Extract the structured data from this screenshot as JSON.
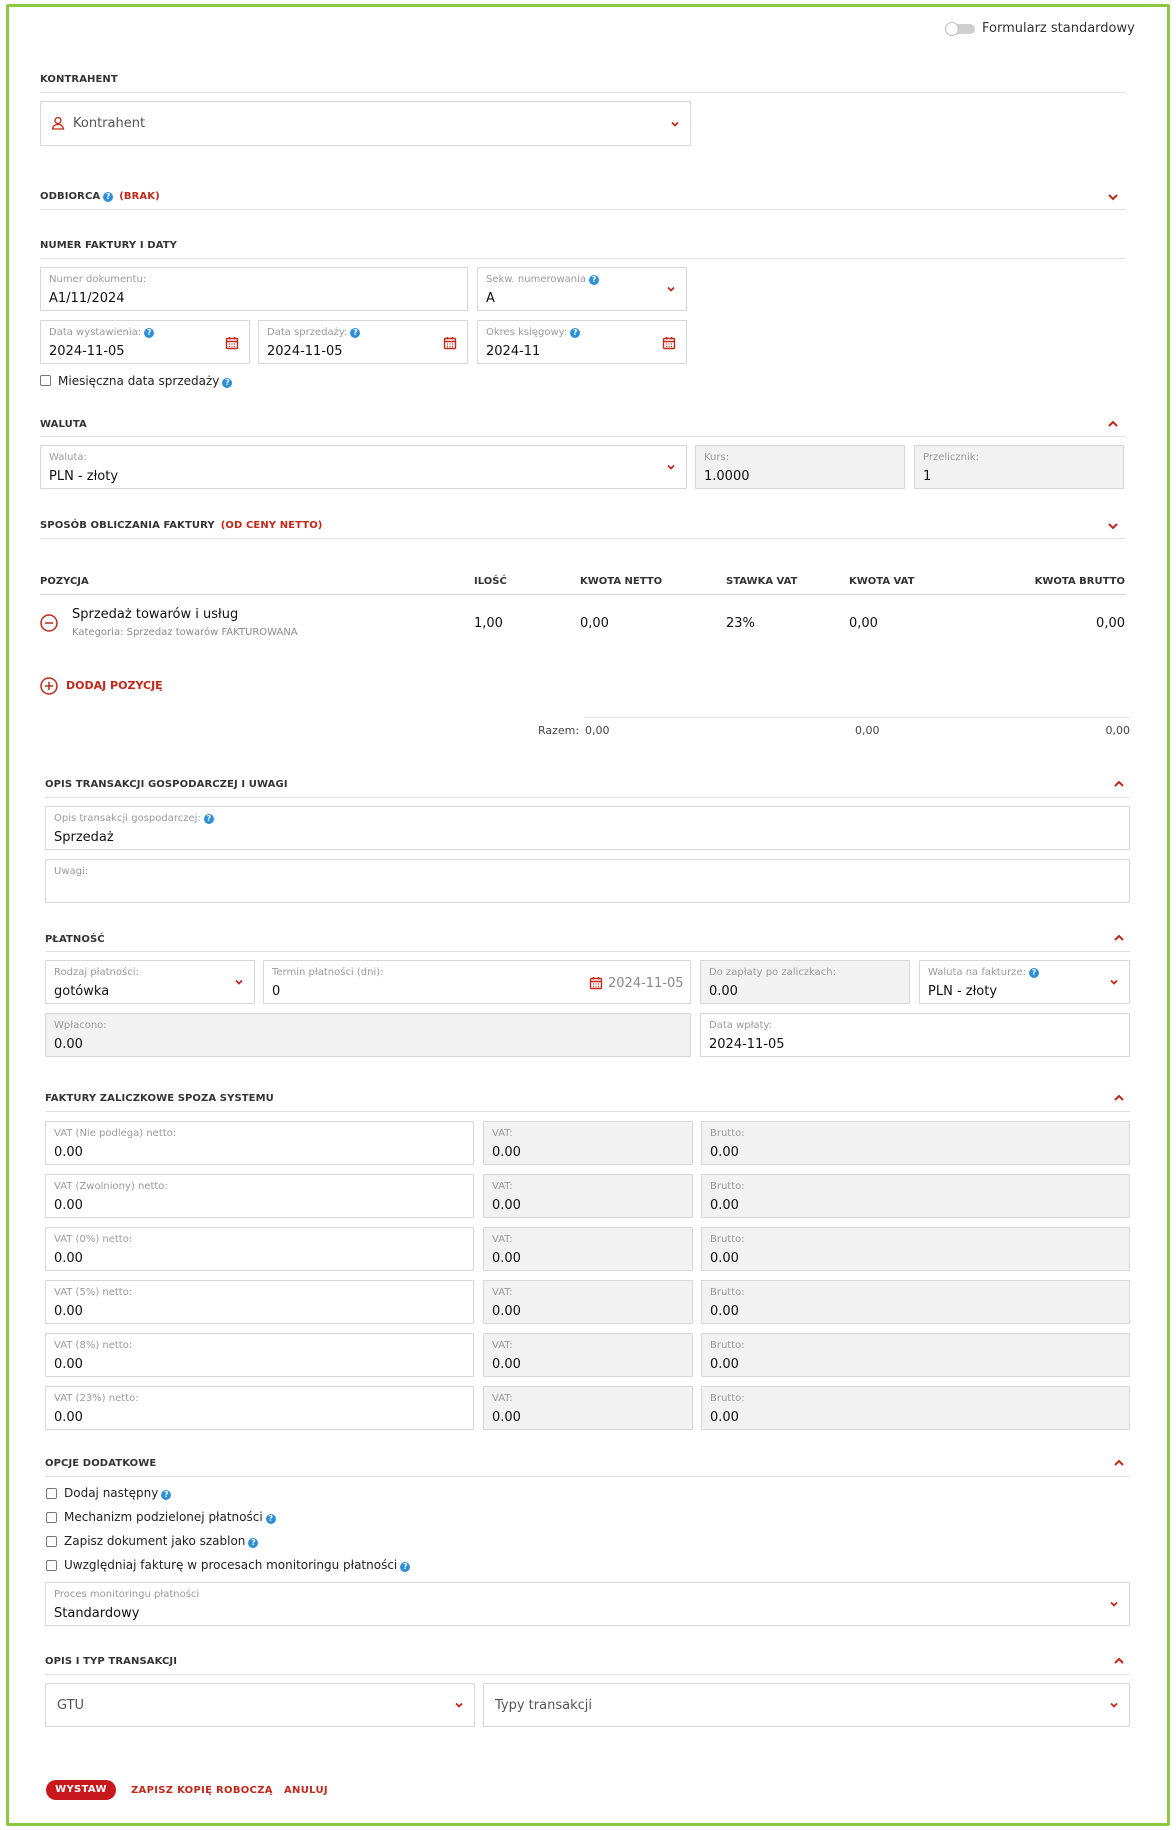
{
  "toggle": {
    "label": "Formularz standardowy"
  },
  "kontrahent": {
    "title": "KONTRAHENT",
    "placeholder": "Kontrahent"
  },
  "odbiorca": {
    "title": "ODBIORCA",
    "status": "(BRAK)"
  },
  "numer": {
    "title": "NUMER FAKTURY I DATY",
    "doc_number": {
      "label": "Numer dokumentu:",
      "value": "A1/11/2024"
    },
    "sequence": {
      "label": "Sekw. numerowania",
      "value": "A"
    },
    "issue_date": {
      "label": "Data wystawienia:",
      "value": "2024-11-05"
    },
    "sale_date": {
      "label": "Data sprzedaży:",
      "value": "2024-11-05"
    },
    "period": {
      "label": "Okres księgowy:",
      "value": "2024-11"
    },
    "monthly_label": "Miesięczna data sprzedaży"
  },
  "waluta": {
    "title": "WALUTA",
    "currency": {
      "label": "Waluta:",
      "value": "PLN - złoty"
    },
    "rate": {
      "label": "Kurs:",
      "value": "1.0000"
    },
    "converter": {
      "label": "Przelicznik:",
      "value": "1"
    }
  },
  "sposob": {
    "title": "SPOSÓB OBLICZANIA FAKTURY",
    "value": "(OD CENY NETTO)"
  },
  "positions": {
    "headers": [
      "POZYCJA",
      "ILOŚĆ",
      "KWOTA NETTO",
      "STAWKA VAT",
      "KWOTA VAT",
      "KWOTA BRUTTO"
    ],
    "rows": [
      {
        "name": "Sprzedaż towarów i usług",
        "category": "Kategoria: Sprzedaz towarów FAKTUROWANA",
        "qty": "1,00",
        "net": "0,00",
        "vat_rate": "23%",
        "vat": "0,00",
        "gross": "0,00"
      }
    ],
    "add_label": "DODAJ POZYCJĘ",
    "total_label": "Razem:",
    "total_net": "0,00",
    "total_vat": "0,00",
    "total_gross": "0,00"
  },
  "opis": {
    "title": "OPIS TRANSAKCJI GOSPODARCZEJ I UWAGI",
    "desc": {
      "label": "Opis transakcji gospodarczej:",
      "value": "Sprzedaż"
    },
    "notes": {
      "label": "Uwagi:",
      "value": ""
    }
  },
  "platnosc": {
    "title": "PŁATNOŚĆ",
    "type": {
      "label": "Rodzaj płatności:",
      "value": "gotówka"
    },
    "term": {
      "label": "Termin płatności (dni):",
      "value": "0",
      "date": "2024-11-05"
    },
    "to_pay": {
      "label": "Do zapłaty po zaliczkach:",
      "value": "0.00"
    },
    "invoice_currency": {
      "label": "Waluta na fakturze:",
      "value": "PLN - złoty"
    },
    "paid": {
      "label": "Wpłacono:",
      "value": "0.00"
    },
    "paid_date": {
      "label": "Data wpłaty:",
      "value": "2024-11-05"
    }
  },
  "zaliczki": {
    "title": "FAKTURY ZALICZKOWE SPOZA SYSTEMU",
    "vat_label": "VAT:",
    "gross_label": "Brutto:",
    "rows": [
      {
        "label": "VAT (Nie podlega) netto:",
        "net": "0.00",
        "vat": "0.00",
        "gross": "0.00"
      },
      {
        "label": "VAT (Zwolniony) netto:",
        "net": "0.00",
        "vat": "0.00",
        "gross": "0.00"
      },
      {
        "label": "VAT (0%) netto:",
        "net": "0.00",
        "vat": "0.00",
        "gross": "0.00"
      },
      {
        "label": "VAT (5%) netto:",
        "net": "0.00",
        "vat": "0.00",
        "gross": "0.00"
      },
      {
        "label": "VAT (8%) netto:",
        "net": "0.00",
        "vat": "0.00",
        "gross": "0.00"
      },
      {
        "label": "VAT (23%) netto:",
        "net": "0.00",
        "vat": "0.00",
        "gross": "0.00"
      }
    ]
  },
  "opcje": {
    "title": "OPCJE DODATKOWE",
    "checkboxes": [
      "Dodaj następny",
      "Mechanizm podzielonej płatności",
      "Zapisz dokument jako szablon",
      "Uwzględniaj fakturę w procesach monitoringu płatności"
    ],
    "monitoring": {
      "label": "Proces monitoringu płatności",
      "value": "Standardowy"
    }
  },
  "typ": {
    "title": "OPIS I TYP TRANSAKCJI",
    "gtu_placeholder": "GTU",
    "types_placeholder": "Typy transakcji"
  },
  "actions": {
    "submit": "WYSTAW",
    "draft": "ZAPISZ KOPIĘ ROBOCZĄ",
    "cancel": "ANULUJ"
  },
  "colors": {
    "accent": "#c0281a",
    "frame": "#8dc63f",
    "help": "#2e8ed8"
  }
}
